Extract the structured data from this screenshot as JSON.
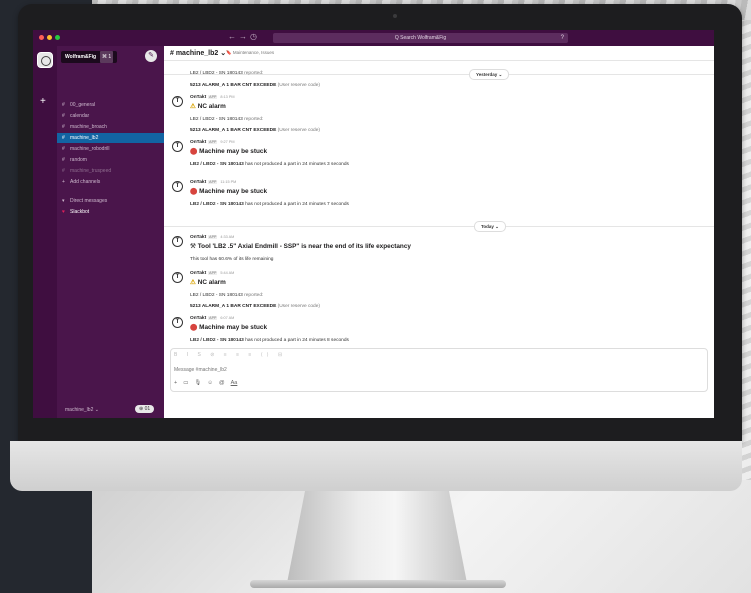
{
  "titlebar": {
    "search_placeholder": "Q  Search Wolfram&Fig",
    "dots": [
      "#ff5f57",
      "#febc2e",
      "#28c840"
    ]
  },
  "sidebar": {
    "workspace": "Wolfram&Fig",
    "workspace_badge": "⌘ 1",
    "channels": [
      {
        "label": "00_general",
        "state": "normal"
      },
      {
        "label": "calendar",
        "state": "normal"
      },
      {
        "label": "machine_broach",
        "state": "normal"
      },
      {
        "label": "machine_lb2",
        "state": "active"
      },
      {
        "label": "machine_robodrill",
        "state": "normal"
      },
      {
        "label": "random",
        "state": "normal"
      },
      {
        "label": "machine_truspeed",
        "state": "muted"
      }
    ],
    "add_channels": "Add channels",
    "direct_messages": "Direct messages",
    "dm_user": "Slackbot",
    "footer_channel": "machine_lb2 ⌄",
    "footer_button": "⊕ 01"
  },
  "channel": {
    "name": "# machine_lb2 ⌄",
    "topic": "Maintenance, Issues"
  },
  "days": {
    "yesterday": "Yesterday ⌄",
    "today": "Today ⌄"
  },
  "messages": {
    "m0_line1": "LB2 / LBD2 - SN 180143 ",
    "m0_line1_muted": "reported:",
    "m0_line2": "5213 ALARM_A 1 BAR CNT EXCEEDE ",
    "m0_line2_muted": "(User reserve code)",
    "m1_sender": "OnTakt",
    "m1_app": "APP",
    "m1_time": "8:13 PM",
    "m1_title": "NC alarm",
    "m1_line1": "LB2 / LBD2 - SN 180143 ",
    "m1_line1_muted": "reported:",
    "m1_line2": "5213 ALARM_A 1 BAR CNT EXCEEDE ",
    "m1_line2_muted": "(User reserve code)",
    "m2_sender": "OnTakt",
    "m2_app": "APP",
    "m2_time": "9:27 PM",
    "m2_title": "Machine may be stuck",
    "m2_line1": "LB2 / LBD2 - SN 180143 ",
    "m2_line1_rest": "has not produced a part in 24 minutes 3 seconds",
    "m3_sender": "OnTakt",
    "m3_app": "APP",
    "m3_time": "11:15 PM",
    "m3_title": "Machine may be stuck",
    "m3_line1": "LB2 / LBD2 - SN 180143 ",
    "m3_line1_rest": "has not produced a part in 24 minutes 7 seconds",
    "m4_sender": "OnTakt",
    "m4_app": "APP",
    "m4_time": "4:33 AM",
    "m4_title": "Tool 'LB2 .5\" Axial Endmill - SSP'' is near the end of its life expectancy",
    "m4_line1": "This tool has 60.6% of its life remaining",
    "m5_sender": "OnTakt",
    "m5_app": "APP",
    "m5_time": "5:44 AM",
    "m5_title": "NC alarm",
    "m5_line1": "LB2 / LBD2 - SN 180143 ",
    "m5_line1_muted": "reported:",
    "m5_line2": "5213 ALARM_A 1 BAR CNT EXCEEDE ",
    "m5_line2_muted": "(User reserve code)",
    "m6_sender": "OnTakt",
    "m6_app": "APP",
    "m6_time": "6:07 AM",
    "m6_title": "Machine may be stuck",
    "m6_line1": "LB2 / LBD2 - SN 180143 ",
    "m6_line1_rest": "has not produced a part in 24 minutes 8 seconds"
  },
  "composer": {
    "format_bar": "B  I  S  ⊘  ≡  ≡  ≡  ⟨⟩  ⊟",
    "placeholder": "Message #machine_lb2",
    "tools": [
      "+",
      "▭",
      "🎙",
      "☺",
      "@",
      "Aa"
    ]
  }
}
